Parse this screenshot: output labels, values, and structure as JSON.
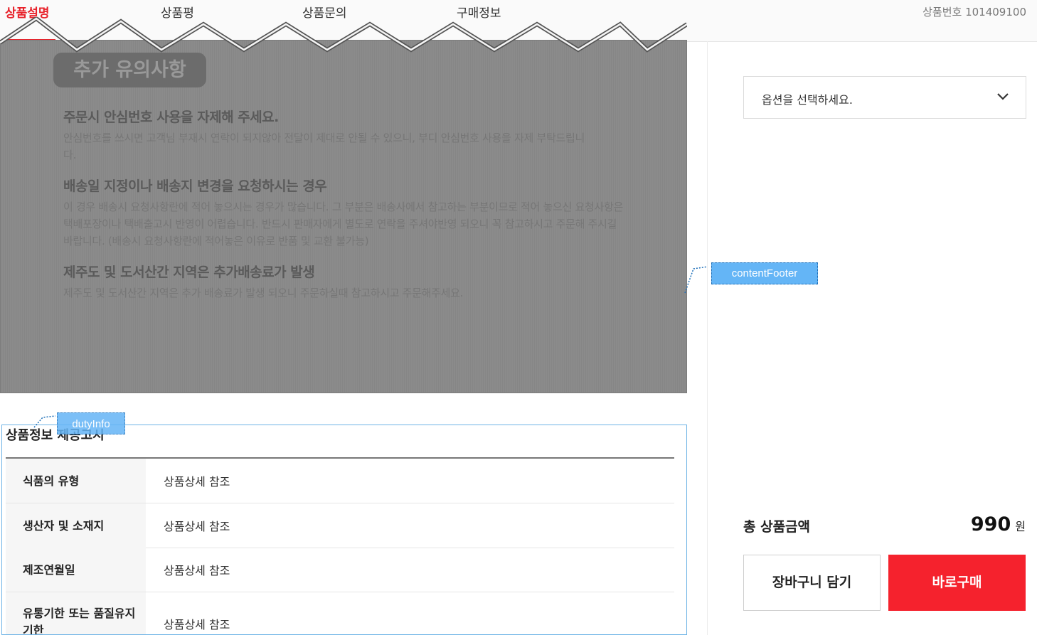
{
  "tabs": [
    {
      "label": "상품설명"
    },
    {
      "label": "상품평"
    },
    {
      "label": "상품문의"
    },
    {
      "label": "구매정보"
    }
  ],
  "product_no": "상품번호 101409100",
  "notice": {
    "badge": "추가 유의사항",
    "sections": [
      {
        "heading": "주문시 안심번호 사용을 자제해 주세요.",
        "body": "안심번호를 쓰시면 고객님 부재시 연락이 되지않아 전달이 제대로 안될 수 있으니, 부디 안심번호 사용을 자제 부탁드립니다."
      },
      {
        "heading": "배송일 지정이나 배송지 변경을 요청하시는 경우",
        "body": "이 경우 배송시 요청사항란에 적어 놓으시는 경우가 많습니다. 그 부분은 배송사에서 참고하는 부분이므로 적어 놓으신 요청사항은 택배포장이나 택배출고시 반영이 어렵습니다. 반드시 판매자에게 별도로 연락을 주셔야반영 되오니 꼭 참고하시고 주문해 주시길 바랍니다. (배송시 요청사항란에 적어놓은 이유로 반품 및 교환 불가능)"
      },
      {
        "heading": "제주도 및 도서산간 지역은 추가배송료가 발생",
        "body": "제주도 및 도서산간 지역은 추가 배송료가 발생 되오니 주문하실때 참고하시고 주문해주세요."
      }
    ]
  },
  "debug_tags": {
    "content_footer": "contentFooter",
    "duty_info": "dutyInfo"
  },
  "duty": {
    "title": "상품정보 제공고시",
    "rows": [
      {
        "key": "식품의 유형",
        "value": "상품상세 참조"
      },
      {
        "key": "생산자 및 소재지",
        "value": "상품상세 참조"
      },
      {
        "key": "제조연월일",
        "value": "상품상세 참조"
      },
      {
        "key": "유통기한 또는 품질유지기한",
        "value": "상품상세 참조"
      }
    ]
  },
  "option_select": {
    "placeholder": "옵션을 선택하세요.",
    "icon": "chevron-down-icon"
  },
  "total": {
    "label": "총 상품금액",
    "amount": "990",
    "unit": "원"
  },
  "buttons": {
    "cart": "장바구니 담기",
    "buy": "바로구매"
  },
  "colors": {
    "accent": "#e8232b",
    "buy_button": "#f5222d",
    "tag": "#64b5f6",
    "overlay": "#8b8b8b"
  }
}
